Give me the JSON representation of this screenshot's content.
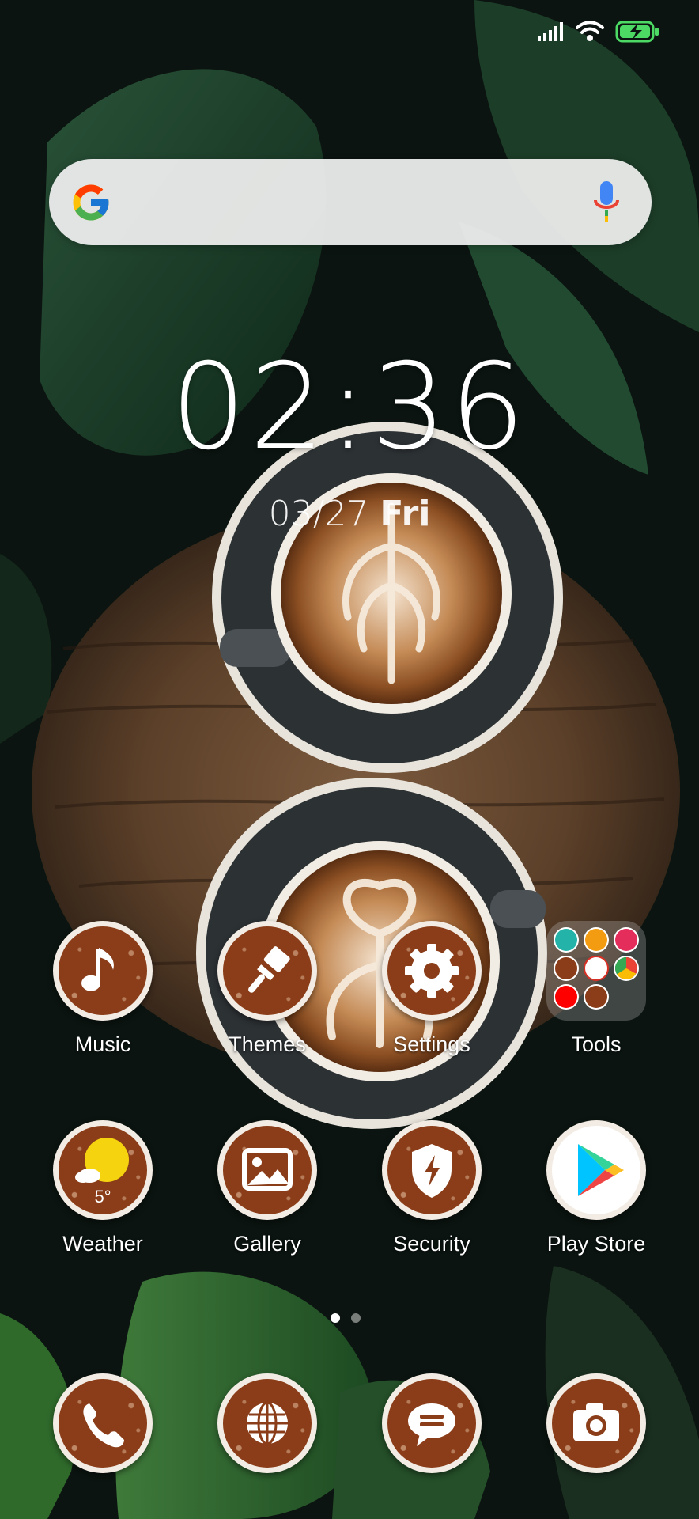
{
  "status_bar": {
    "icons": [
      "cellular-signal-icon",
      "wifi-icon",
      "battery-charging-icon"
    ],
    "battery_color": "#4cd964"
  },
  "search": {
    "logo": "google-logo",
    "mic_icon": "voice-search-mic-icon"
  },
  "clock": {
    "time": "02:36",
    "date": "03/27",
    "day": "Fri"
  },
  "apps_row1": [
    {
      "name": "Music",
      "icon": "music-note-icon"
    },
    {
      "name": "Themes",
      "icon": "paintbrush-icon"
    },
    {
      "name": "Settings",
      "icon": "gear-icon"
    },
    {
      "name": "Tools",
      "icon": "folder-icon"
    }
  ],
  "apps_row2": [
    {
      "name": "Weather",
      "icon": "weather-sun-cloud-icon",
      "temp": "5°"
    },
    {
      "name": "Gallery",
      "icon": "image-icon"
    },
    {
      "name": "Security",
      "icon": "shield-bolt-icon"
    },
    {
      "name": "Play Store",
      "icon": "play-store-icon"
    }
  ],
  "tools_folder": [
    "scanner-icon",
    "play-games-icon",
    "play-movies-icon",
    "contacts-icon",
    "gmail-icon",
    "chrome-icon",
    "youtube-icon",
    "screen-recorder-icon"
  ],
  "dock": [
    {
      "icon": "phone-icon"
    },
    {
      "icon": "browser-globe-icon"
    },
    {
      "icon": "messages-icon"
    },
    {
      "icon": "camera-icon"
    }
  ],
  "pager": {
    "pages": 2,
    "current": 1
  },
  "colors": {
    "icon_brown": "#8a3d18",
    "icon_rim": "#f3ece4"
  }
}
